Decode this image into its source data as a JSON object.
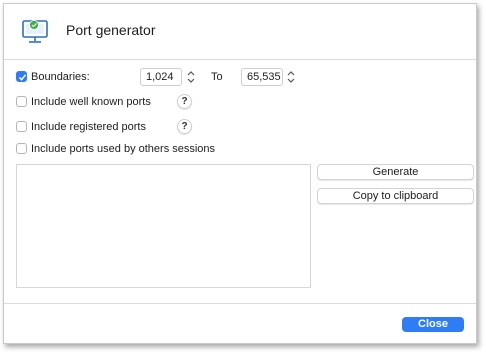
{
  "window": {
    "title": "Port generator",
    "app_icon": "monitor-network-icon"
  },
  "boundaries": {
    "label": "Boundaries:",
    "checked": true,
    "from_value": "1,024",
    "to_label": "To",
    "to_value": "65,535"
  },
  "options": [
    {
      "label": "Include well known ports",
      "checked": false,
      "help": "?"
    },
    {
      "label": "Include registered ports",
      "checked": false,
      "help": "?"
    },
    {
      "label": "Include ports used by others sessions",
      "checked": false
    }
  ],
  "output": {
    "value": ""
  },
  "actions": {
    "generate_label": "Generate",
    "copy_label": "Copy to clipboard"
  },
  "footer": {
    "close_label": "Close"
  },
  "colors": {
    "accent": "#2e7cf6",
    "icon_green": "#3fae49"
  }
}
